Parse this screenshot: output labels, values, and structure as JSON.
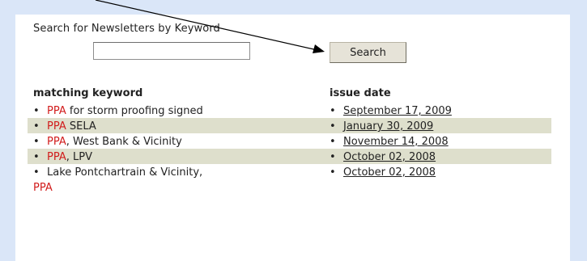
{
  "search": {
    "label": "Search for Newsletters by Keyword",
    "input_value": "",
    "button_label": "Search"
  },
  "table": {
    "headers": {
      "keyword": "matching keyword",
      "date": "issue date"
    },
    "bullet": "•",
    "rows": [
      {
        "keyword_highlight": "PPA",
        "keyword_rest": " for storm proofing signed",
        "date": "September 17, 2009"
      },
      {
        "keyword_highlight": "PPA",
        "keyword_rest": " SELA",
        "date": "January 30, 2009"
      },
      {
        "keyword_highlight": "PPA",
        "keyword_rest": ", West Bank & Vicinity",
        "date": "November 14, 2008"
      },
      {
        "keyword_highlight": "PPA",
        "keyword_rest": ", LPV",
        "date": "October 02, 2008"
      },
      {
        "keyword_prefix": "Lake Pontchartrain & Vicinity,",
        "keyword_highlight": "PPA",
        "date": "October 02, 2008"
      }
    ]
  }
}
